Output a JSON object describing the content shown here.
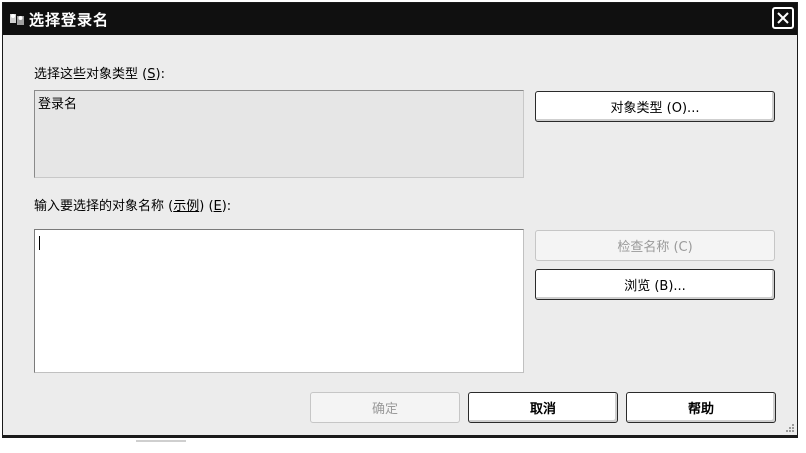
{
  "window": {
    "title": "选择登录名"
  },
  "object_types": {
    "label": "选择这些对象类型",
    "accel": "S",
    "suffix": "):",
    "value": "登录名",
    "button_label": "对象类型 (O)..."
  },
  "object_names": {
    "label_main": "输入要选择的对象名称 (",
    "label_link": "示例",
    "label_mid": ") (",
    "accel": "E",
    "label_end": "):",
    "value": ""
  },
  "buttons": {
    "check_names": "检查名称 (C)",
    "browse": "浏览 (B)...",
    "ok": "确定",
    "cancel": "取消",
    "help": "帮助"
  }
}
